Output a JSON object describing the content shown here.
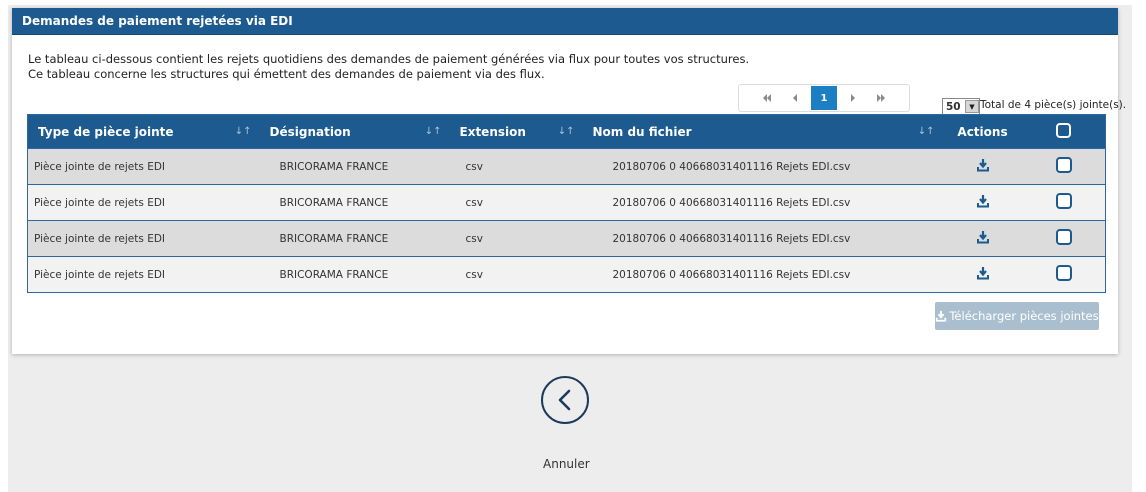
{
  "panel": {
    "title": "Demandes de paiement rejetées via EDI",
    "intro_line1": "Le tableau ci-dessous contient les rejets quotidiens des demandes de paiement générées via flux pour toutes vos structures.",
    "intro_line2": "Ce tableau concerne les structures qui émettent des demandes de paiement via des flux."
  },
  "pagination": {
    "first_icon": "double-chevron-left-icon",
    "prev_icon": "chevron-left-icon",
    "current_page": "1",
    "next_icon": "chevron-right-icon",
    "last_icon": "double-chevron-right-icon",
    "page_size": "50",
    "total_text": "Total de 4 pièce(s) jointe(s)."
  },
  "table": {
    "columns": [
      "Type de pièce jointe",
      "Désignation",
      "Extension",
      "Nom du fichier",
      "Actions"
    ],
    "rows": [
      {
        "type": "Pièce jointe de rejets EDI",
        "designation": "BRICORAMA FRANCE",
        "extension": "csv",
        "filename": "20180706 0 40668031401116 Rejets EDI.csv"
      },
      {
        "type": "Pièce jointe de rejets EDI",
        "designation": "BRICORAMA FRANCE",
        "extension": "csv",
        "filename": "20180706 0 40668031401116 Rejets EDI.csv"
      },
      {
        "type": "Pièce jointe de rejets EDI",
        "designation": "BRICORAMA FRANCE",
        "extension": "csv",
        "filename": "20180706 0 40668031401116 Rejets EDI.csv"
      },
      {
        "type": "Pièce jointe de rejets EDI",
        "designation": "BRICORAMA FRANCE",
        "extension": "csv",
        "filename": "20180706 0 40668031401116 Rejets EDI.csv"
      }
    ]
  },
  "actions": {
    "download_all_label": "Télécharger pièces jointes",
    "cancel_label": "Annuler"
  },
  "colors": {
    "header_blue": "#1c5a8f",
    "accent_blue": "#1c7fc4",
    "disabled_button": "#a9bfd0"
  }
}
